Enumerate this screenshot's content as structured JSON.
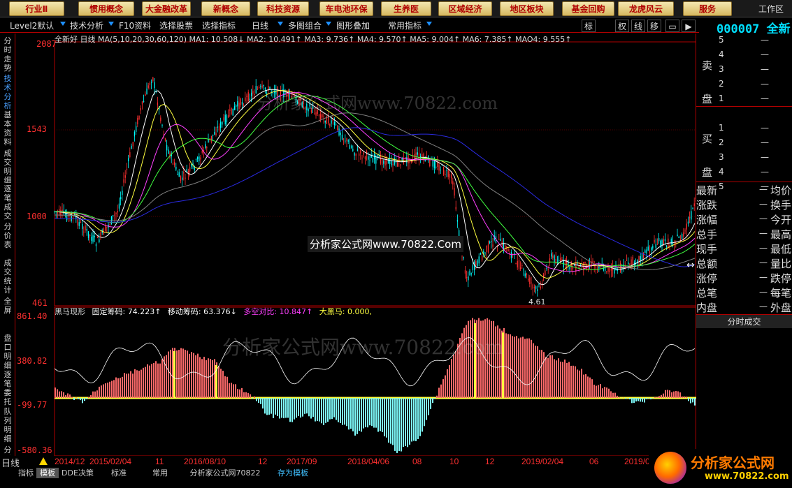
{
  "top_buttons": [
    "行业Ⅱ",
    "惯用概念",
    "大金融改革",
    "新概念",
    "科技资源",
    "车电池环保",
    "生养医",
    "区域经济",
    "地区板块",
    "基金回购",
    "龙虎风云",
    "服务"
  ],
  "work_area": "工作区",
  "toolbar": {
    "items": [
      "Level2默认",
      "技术分析",
      "F10资料",
      "选择股票",
      "选择指标",
      "日线",
      "多图组合",
      "图形叠加",
      "常用指标"
    ],
    "mode_buttons": [
      "标",
      "权",
      "线",
      "移"
    ]
  },
  "stock_code": "000007 全新",
  "left_tabs": [
    "分时走势",
    "技术分析",
    "基本资料",
    "成交明细",
    "逐笔成交",
    "分价表",
    "成交统计",
    "全屏",
    "盘口明细",
    "逐笔委托",
    "队列明细",
    "分时"
  ],
  "main_chart": {
    "legend": "全新好 日线 MA(5,10,20,30,60,120) MA1: 10.508↓ MA2: 10.491↑ MA3: 9.736↑ MA4: 9.570↑ MA5: 9.004↑ MA6: 7.385↑ MAO4: 9.555↑",
    "y_labels": [
      "2087",
      "1543",
      "1000",
      "461"
    ],
    "low_label": "4.61",
    "high_label": "2087"
  },
  "sub_chart": {
    "legend_name": "黑马现形",
    "legend_items": [
      "固定筹码: 74.223↑",
      "移动筹码: 63.376↓",
      "多空对比: 10.847↑",
      "大黑马: 0.000,"
    ],
    "y_labels": [
      "861.40",
      "380.82",
      "-99.77",
      "-580.36"
    ]
  },
  "date_axis": [
    "2014/12",
    "2015/02/04",
    "11",
    "2016/08/10",
    "12",
    "2017/09",
    "2018/04/06",
    "08",
    "10",
    "12",
    "2019/02/04",
    "06",
    "2019/0"
  ],
  "period_label": "日线",
  "bottom_tabs": [
    "指标",
    "模板",
    "DDE决策",
    "标准",
    "常用",
    "分析家公式网70822",
    "存为模板"
  ],
  "right_panel": {
    "sell_label": "卖盘",
    "buy_label": "买盘",
    "levels": [
      "5",
      "4",
      "3",
      "2",
      "1"
    ],
    "dash": "—",
    "stats": [
      [
        "最新",
        "均价"
      ],
      [
        "涨跌",
        "换手"
      ],
      [
        "涨幅",
        "今开"
      ],
      [
        "总手",
        "最高"
      ],
      [
        "现手",
        "最低"
      ],
      [
        "总额",
        "量比"
      ],
      [
        "涨停",
        "跌停"
      ],
      [
        "总笔",
        "每笔"
      ],
      [
        "内盘",
        "外盘"
      ]
    ],
    "tick_label": "分时成交"
  },
  "watermarks": [
    "分析家公式网www.70822.com",
    "分析家公式网www.70822.Com",
    "分析家公式网www.70822.com"
  ],
  "logo": {
    "title": "分析家公式网",
    "url": "www.70822.com"
  },
  "colors": {
    "accent_red": "#b00000",
    "up": "#ff3030",
    "down": "#00ffff",
    "ma_blue": "#2a2ae0",
    "ma_yellow": "#ffff40"
  }
}
